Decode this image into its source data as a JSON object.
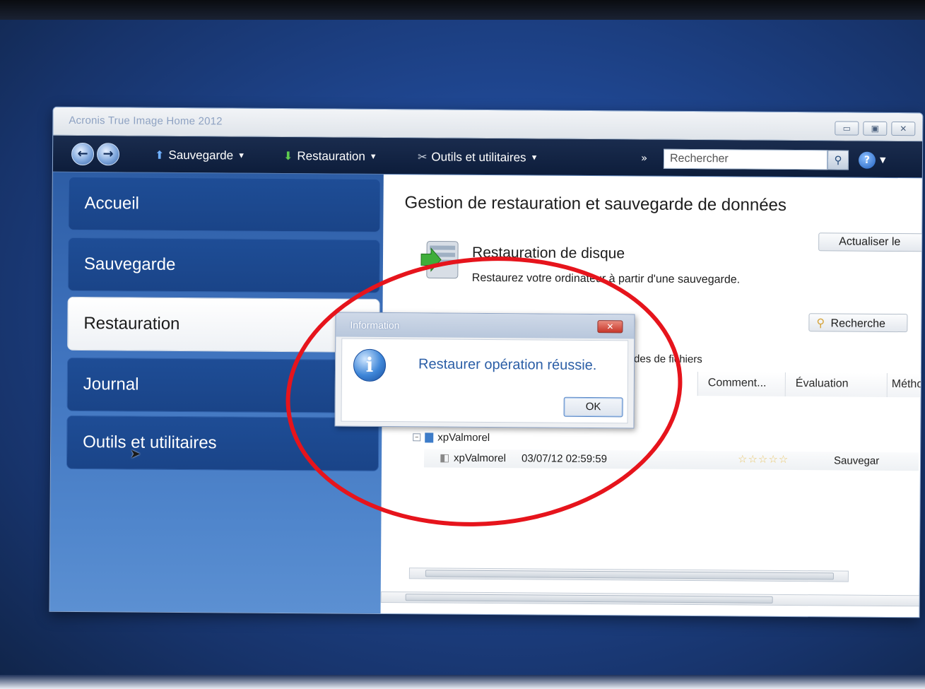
{
  "window": {
    "title": "Acronis True Image Home 2012",
    "controls": {
      "minimize": "▭",
      "maximize": "▣",
      "close": "✕"
    }
  },
  "toolbar": {
    "backup_label": "Sauvegarde",
    "restore_label": "Restauration",
    "tools_label": "Outils et utilitaires",
    "more_label": "»",
    "search_placeholder": "Rechercher",
    "help_label": "?"
  },
  "sidebar": {
    "items": [
      {
        "label": "Accueil",
        "active": false
      },
      {
        "label": "Sauvegarde",
        "active": false
      },
      {
        "label": "Restauration",
        "active": true
      },
      {
        "label": "Journal",
        "active": false
      },
      {
        "label": "Outils et utilitaires",
        "active": false
      }
    ]
  },
  "main": {
    "title": "Gestion de restauration et sauvegarde de données",
    "refresh_button": "Actualiser le",
    "restore_disk_title": "Restauration de disque",
    "restore_disk_desc": "Restaurez votre ordinateur à partir d'une sauvegarde.",
    "search_button": "Recherche",
    "section_label": "des de fichiers",
    "columns": [
      "Comment...",
      "Évaluation",
      "Méthode"
    ],
    "tree_group": "xpValmorel",
    "rows": [
      {
        "name": "xpValmorel",
        "date": "03/07/12 02:59:59",
        "stars": "☆☆☆☆☆",
        "method": "Sauvegar"
      }
    ]
  },
  "dialog": {
    "title": "Information",
    "message": "Restaurer opération réussie.",
    "ok_label": "OK",
    "close_label": "✕",
    "icon_glyph": "i"
  },
  "icons": {
    "back": "search-icon",
    "colors": {
      "accent": "#2b5ea6",
      "annotation": "#e6141c"
    }
  }
}
